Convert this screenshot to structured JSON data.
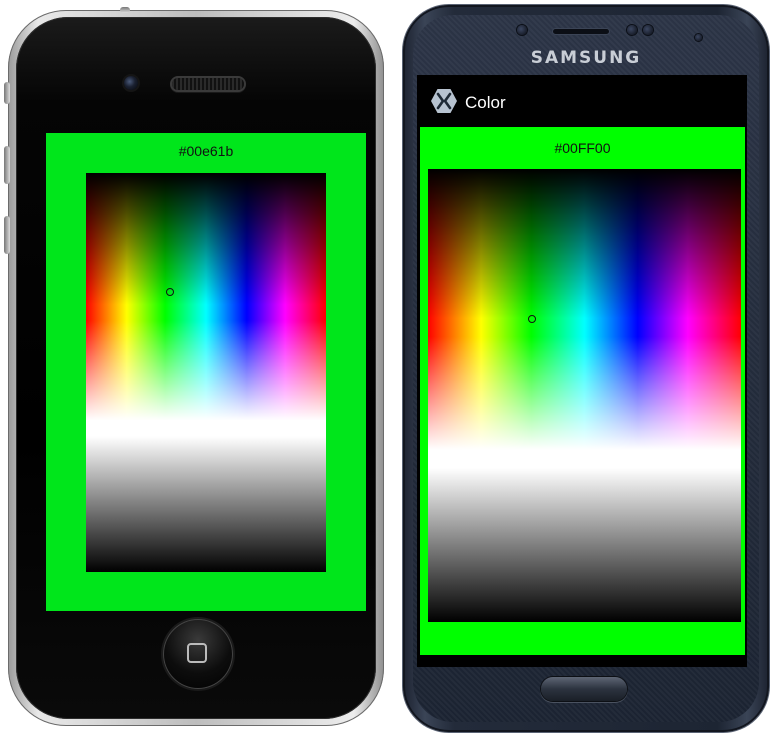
{
  "iphone": {
    "color_label": "#00e61b",
    "background_color": "#00e61b"
  },
  "android": {
    "brand": "SAMSUNG",
    "app_title": "Color",
    "app_icon": "xamarin-icon",
    "color_label": "#00FF00",
    "background_color": "#00FF00"
  }
}
